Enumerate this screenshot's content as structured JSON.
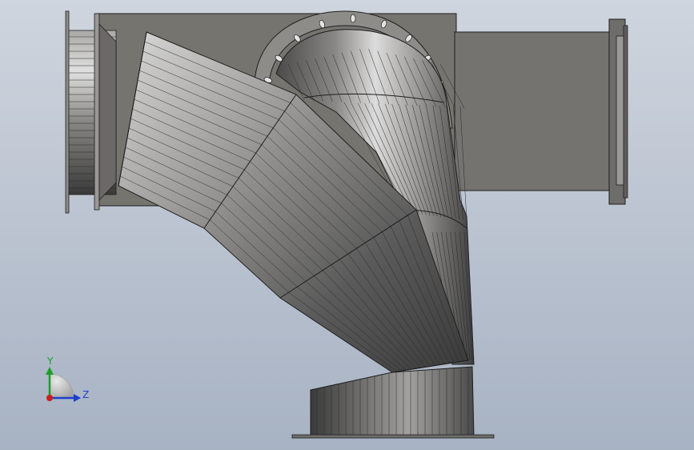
{
  "viewport": {
    "background_top": "#cfd5de",
    "background_bottom": "#a7b2c3"
  },
  "model": {
    "colors": {
      "steel_dark": "#4a4a4a",
      "steel_mid": "#8c8a87",
      "steel_light": "#d8d8d8",
      "plate": "#757370",
      "edge": "#1e1e1e"
    }
  },
  "triad": {
    "y_label": "Y",
    "z_label": "Z",
    "y_color": "#1e9e2a",
    "z_color": "#1d3fcf",
    "x_color": "#c81e1e"
  }
}
